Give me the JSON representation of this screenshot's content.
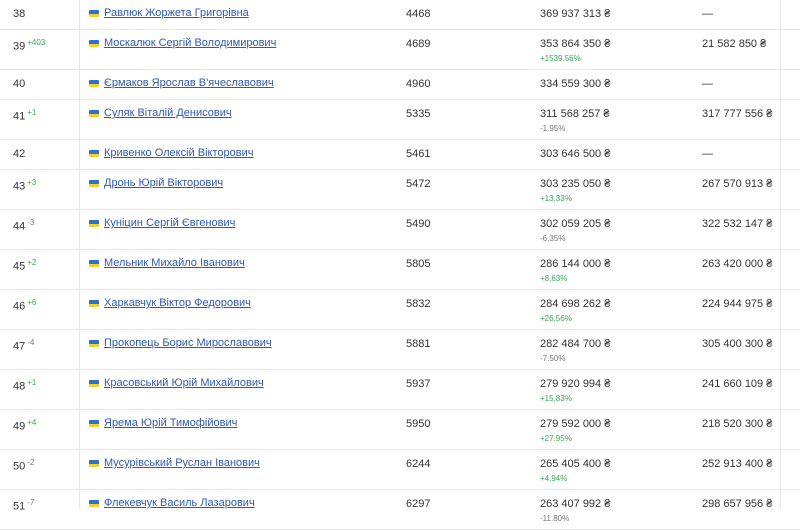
{
  "rows": [
    {
      "rank": "38",
      "delta": "",
      "name": "Равлюк Жоржета Григорівна",
      "num": "4468",
      "income": "369 937 313 ₴",
      "pct": "",
      "prev": "—"
    },
    {
      "rank": "39",
      "delta": "+403",
      "name": "Москалюк Сергій Володимирович",
      "num": "4689",
      "income": "353 864 350 ₴",
      "pct": "+1539.56%",
      "prev": "21 582 850 ₴"
    },
    {
      "rank": "40",
      "delta": "",
      "name": "Єрмаков Ярослав В'ячеславович",
      "num": "4960",
      "income": "334 559 300 ₴",
      "pct": "",
      "prev": "—"
    },
    {
      "rank": "41",
      "delta": "+1",
      "name": "Суляк Віталій Денисович",
      "num": "5335",
      "income": "311 568 257 ₴",
      "pct": "-1.95%",
      "prev": "317 777 556 ₴"
    },
    {
      "rank": "42",
      "delta": "",
      "name": "Кривенко Олексій Вікторович",
      "num": "5461",
      "income": "303 646 500 ₴",
      "pct": "",
      "prev": "—"
    },
    {
      "rank": "43",
      "delta": "+3",
      "name": "Дронь Юрій Вікторович",
      "num": "5472",
      "income": "303 235 050 ₴",
      "pct": "+13.33%",
      "prev": "267 570 913 ₴"
    },
    {
      "rank": "44",
      "delta": "-3",
      "name": "Куніцин Сергій Євгенович",
      "num": "5490",
      "income": "302 059 205 ₴",
      "pct": "-6.35%",
      "prev": "322 532 147 ₴"
    },
    {
      "rank": "45",
      "delta": "+2",
      "name": "Мельник Михайло Іванович",
      "num": "5805",
      "income": "286 144 000 ₴",
      "pct": "+8.63%",
      "prev": "263 420 000 ₴"
    },
    {
      "rank": "46",
      "delta": "+6",
      "name": "Харкавчук Віктор Федорович",
      "num": "5832",
      "income": "284 698 262 ₴",
      "pct": "+26.56%",
      "prev": "224 944 975 ₴"
    },
    {
      "rank": "47",
      "delta": "-4",
      "name": "Прокопець Борис Мирославович",
      "num": "5881",
      "income": "282 484 700 ₴",
      "pct": "-7.50%",
      "prev": "305 400 300 ₴"
    },
    {
      "rank": "48",
      "delta": "+1",
      "name": "Красовський Юрій Михайлович",
      "num": "5937",
      "income": "279 920 994 ₴",
      "pct": "+15.83%",
      "prev": "241 660 109 ₴"
    },
    {
      "rank": "49",
      "delta": "+4",
      "name": "Ярема Юрій Тимофійович",
      "num": "5950",
      "income": "279 592 000 ₴",
      "pct": "+27.95%",
      "prev": "218 520 300 ₴"
    },
    {
      "rank": "50",
      "delta": "-2",
      "name": "Мусурівський Руслан Іванович",
      "num": "6244",
      "income": "265 405 400 ₴",
      "pct": "+4.94%",
      "prev": "252 913 400 ₴"
    },
    {
      "rank": "51",
      "delta": "-7",
      "name": "Флекевчук Василь Лазарович",
      "num": "6297",
      "income": "263 407 992 ₴",
      "pct": "-11.80%",
      "prev": "298 657 956 ₴"
    }
  ],
  "colors": {
    "link": "#2f59b3",
    "up": "#3aa757",
    "down": "#777777",
    "flag_blue": "#2f6fd6",
    "flag_yellow": "#f6d12d"
  },
  "icons": {
    "flag": "ukraine-flag-icon"
  }
}
